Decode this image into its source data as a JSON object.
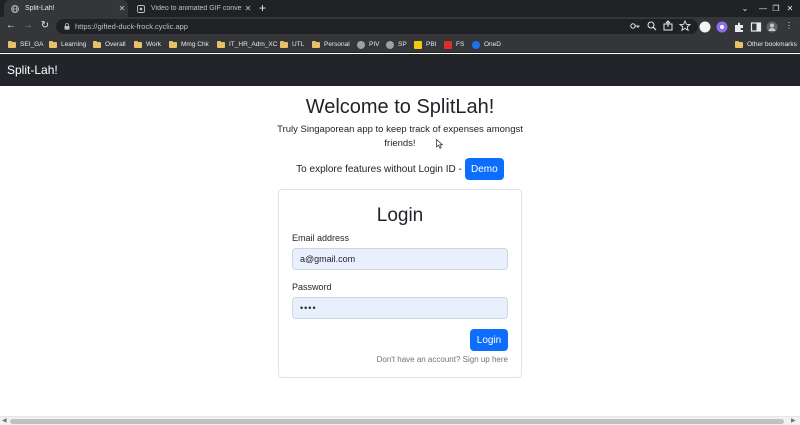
{
  "browser": {
    "tabs": [
      {
        "title": "Split-Lah!",
        "active": true,
        "icon": "globe-icon"
      },
      {
        "title": "Video to animated GIF converter",
        "active": false,
        "icon": "ezgif-icon"
      }
    ],
    "new_tab_label": "+",
    "url": "https://gifted-duck-frock.cyclic.app",
    "bookmarks": [
      {
        "label": "SEI_GA",
        "icon": "folder-icon"
      },
      {
        "label": "Learning",
        "icon": "folder-icon"
      },
      {
        "label": "Overall",
        "icon": "folder-icon"
      },
      {
        "label": "Work",
        "icon": "folder-icon"
      },
      {
        "label": "Mmg Chk",
        "icon": "folder-icon"
      },
      {
        "label": "IT_HR_Adm_XC",
        "icon": "folder-icon"
      },
      {
        "label": "UTL",
        "icon": "folder-icon"
      },
      {
        "label": "Personal",
        "icon": "folder-icon"
      },
      {
        "label": "PIV",
        "icon": "globe-icon"
      },
      {
        "label": "SP",
        "icon": "globe-icon"
      },
      {
        "label": "PBI",
        "icon": "powerbi-icon"
      },
      {
        "label": "FS",
        "icon": "pdf-icon"
      },
      {
        "label": "OneD",
        "icon": "onedrive-icon"
      }
    ],
    "other_bookmarks": "Other bookmarks"
  },
  "app": {
    "brand": "Split-Lah!",
    "title": "Welcome to SplitLah!",
    "subtitle": "Truly Singaporean app to keep track of expenses amongst friends!",
    "demo_text": "To explore features without Login ID -",
    "demo_button": "Demo",
    "login": {
      "title": "Login",
      "email_label": "Email address",
      "email_value": "a@gmail.com",
      "password_label": "Password",
      "password_value": "••••",
      "submit": "Login",
      "signup_text": "Don't have an account? Sign up here"
    }
  },
  "colors": {
    "primary": "#0d6efd",
    "navbar": "#212529",
    "autofill": "#e8f0fe"
  }
}
